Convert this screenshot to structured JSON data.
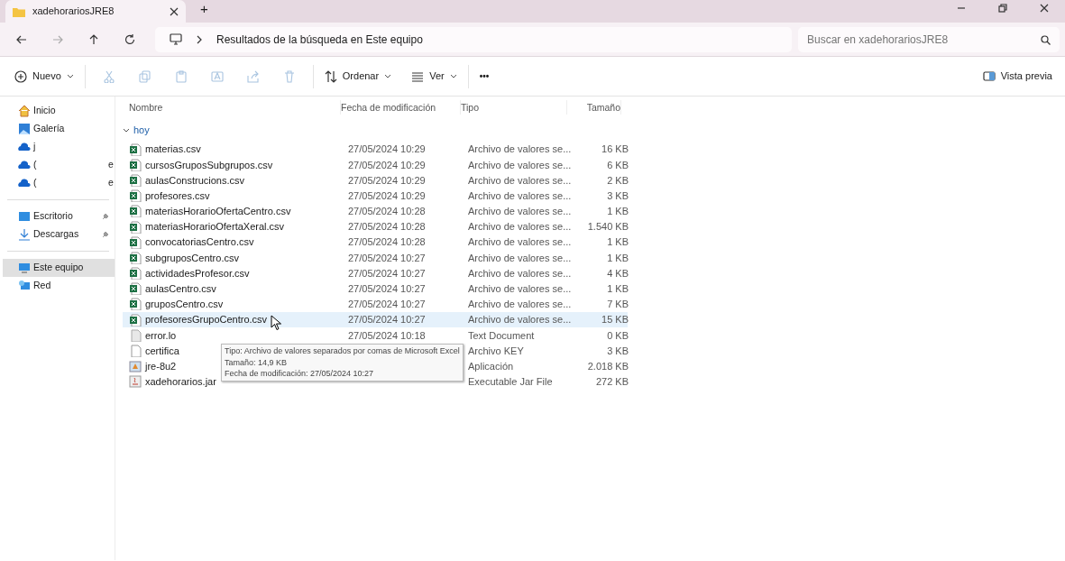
{
  "window": {
    "tab_title": "xadehorariosJRE8",
    "new_tab": "+"
  },
  "address": {
    "path": "Resultados de la búsqueda en Este equipo",
    "search_placeholder": "Buscar en xadehorariosJRE8"
  },
  "toolbar": {
    "new": "Nuevo",
    "sort": "Ordenar",
    "view": "Ver",
    "more": "•••",
    "preview": "Vista previa"
  },
  "sidebar": {
    "groups": [
      [
        {
          "label": "Inicio",
          "kind": "home",
          "selected": false
        },
        {
          "label": "Galería",
          "kind": "gallery",
          "selected": false
        },
        {
          "label": "j",
          "kind": "cloud",
          "selected": false
        },
        {
          "label": "(",
          "kind": "cloud",
          "selected": false,
          "suffix": "e"
        },
        {
          "label": "(",
          "kind": "cloud",
          "selected": false,
          "suffix": "e"
        }
      ],
      [
        {
          "label": "Escritorio",
          "kind": "desktop",
          "selected": false,
          "pinned": true
        },
        {
          "label": "Descargas",
          "kind": "download",
          "selected": false,
          "pinned": true
        }
      ],
      [
        {
          "label": "Este equipo",
          "kind": "pc",
          "selected": true
        },
        {
          "label": "Red",
          "kind": "network",
          "selected": false
        }
      ]
    ]
  },
  "table": {
    "columns": [
      "Nombre",
      "Fecha de modificación",
      "Tipo",
      "Tamaño"
    ],
    "group": "hoy",
    "rows": [
      {
        "name": "materias.csv",
        "date": "27/05/2024 10:29",
        "type": "Archivo de valores se...",
        "size": "16 KB",
        "kind": "excel",
        "selected": false
      },
      {
        "name": "cursosGruposSubgrupos.csv",
        "date": "27/05/2024 10:29",
        "type": "Archivo de valores se...",
        "size": "6 KB",
        "kind": "excel",
        "selected": false
      },
      {
        "name": "aulasConstrucions.csv",
        "date": "27/05/2024 10:29",
        "type": "Archivo de valores se...",
        "size": "2 KB",
        "kind": "excel",
        "selected": false
      },
      {
        "name": "profesores.csv",
        "date": "27/05/2024 10:29",
        "type": "Archivo de valores se...",
        "size": "3 KB",
        "kind": "excel",
        "selected": false
      },
      {
        "name": "materiasHorarioOfertaCentro.csv",
        "date": "27/05/2024 10:28",
        "type": "Archivo de valores se...",
        "size": "1 KB",
        "kind": "excel",
        "selected": false
      },
      {
        "name": "materiasHorarioOfertaXeral.csv",
        "date": "27/05/2024 10:28",
        "type": "Archivo de valores se...",
        "size": "1.540 KB",
        "kind": "excel",
        "selected": false
      },
      {
        "name": "convocatoriasCentro.csv",
        "date": "27/05/2024 10:28",
        "type": "Archivo de valores se...",
        "size": "1 KB",
        "kind": "excel",
        "selected": false
      },
      {
        "name": "subgruposCentro.csv",
        "date": "27/05/2024 10:27",
        "type": "Archivo de valores se...",
        "size": "1 KB",
        "kind": "excel",
        "selected": false
      },
      {
        "name": "actividadesProfesor.csv",
        "date": "27/05/2024 10:27",
        "type": "Archivo de valores se...",
        "size": "4 KB",
        "kind": "excel",
        "selected": false
      },
      {
        "name": "aulasCentro.csv",
        "date": "27/05/2024 10:27",
        "type": "Archivo de valores se...",
        "size": "1 KB",
        "kind": "excel",
        "selected": false
      },
      {
        "name": "gruposCentro.csv",
        "date": "27/05/2024 10:27",
        "type": "Archivo de valores se...",
        "size": "7 KB",
        "kind": "excel",
        "selected": false
      },
      {
        "name": "profesoresGrupoCentro.csv",
        "date": "27/05/2024 10:27",
        "type": "Archivo de valores se...",
        "size": "15 KB",
        "kind": "excel",
        "selected": true,
        "tooltip": [
          "Tipo: Archivo de valores separados por comas de Microsoft Excel",
          "Tamaño: 14,9 KB",
          "Fecha de modificación: 27/05/2024 10:27"
        ]
      },
      {
        "name": "error.lo",
        "date": "27/05/2024 10:18",
        "type": "Text Document",
        "size": "0 KB",
        "kind": "text",
        "selected": false
      },
      {
        "name": "certifica",
        "type": "Archivo KEY",
        "size": "3 KB",
        "kind": "blank",
        "selected": false
      },
      {
        "name": "jre-8u2",
        "type": "Aplicación",
        "size": "2.018 KB",
        "kind": "app",
        "selected": false
      },
      {
        "name": "xadehorarios.jar",
        "type": "Executable Jar File",
        "size": "272 KB",
        "kind": "jar",
        "selected": false
      }
    ]
  }
}
